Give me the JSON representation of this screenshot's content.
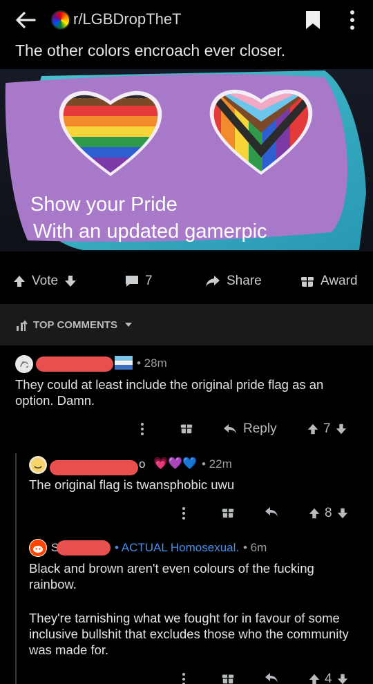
{
  "header": {
    "subreddit": "r/LGBDropTheT"
  },
  "post": {
    "title": "The other colors encroach ever closer.",
    "image_text": {
      "line1": "Show your Pride",
      "line2": "With an updated gamerpic"
    },
    "actions": {
      "vote_label": "Vote",
      "comment_count": "7",
      "share_label": "Share",
      "award_label": "Award"
    }
  },
  "sort": {
    "label": "TOP COMMENTS"
  },
  "comments": [
    {
      "time": "• 28m",
      "body": "They could at least include the original pride flag as an option. Damn.",
      "reply_label": "Reply",
      "score": "7"
    },
    {
      "name_fragment": "o",
      "flair": "💗💜💙",
      "time": "• 22m",
      "body": "The original flag is twansphobic uwu",
      "score": "8"
    },
    {
      "name_fragment": "S",
      "flair": "• ACTUAL Homosexual.",
      "time": "• 6m",
      "body_p1": "Black and brown aren't even colours of the fucking rainbow.",
      "body_p2": "They're tarnishing what we fought for in favour of some inclusive bullshit that excludes those who the community was made for.",
      "score": "4"
    }
  ],
  "colors": {
    "background": "#000000",
    "accent_blue": "#4b8ee8",
    "redaction": "#e84f4f",
    "tile_purple": "#a878c9"
  }
}
